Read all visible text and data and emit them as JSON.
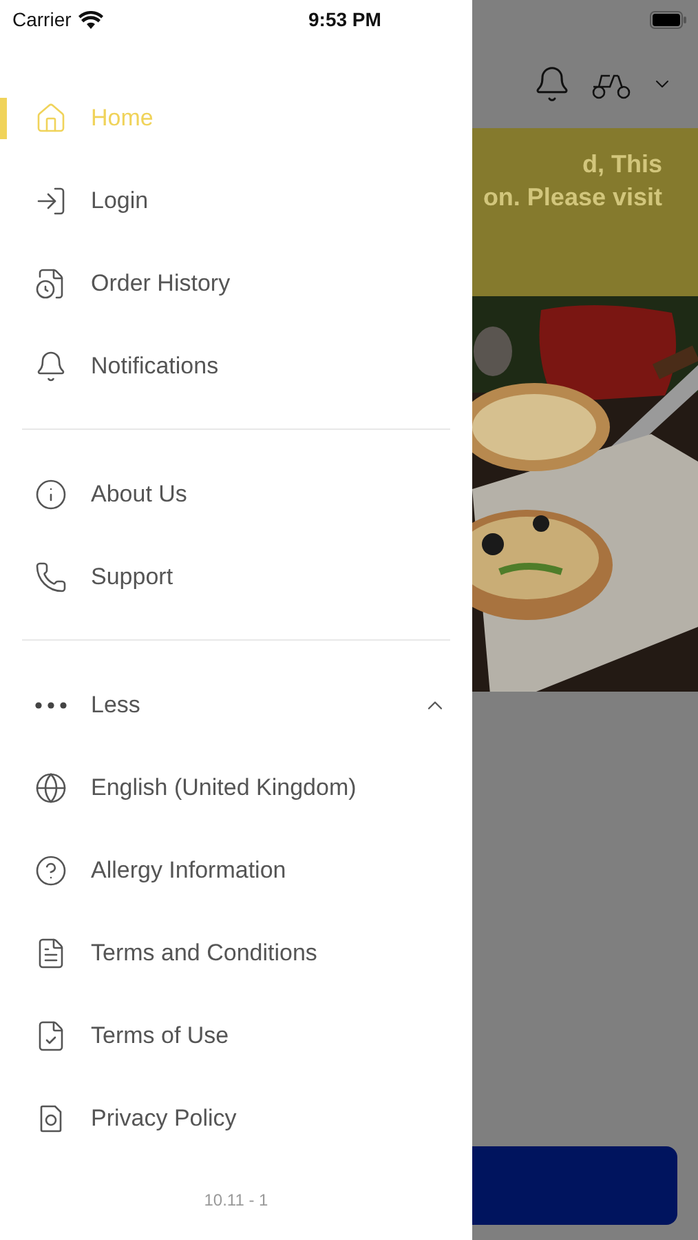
{
  "status_bar": {
    "carrier": "Carrier",
    "time": "9:53 PM"
  },
  "drawer": {
    "sections": [
      {
        "items": [
          {
            "label": "Home",
            "selected": true
          },
          {
            "label": "Login",
            "selected": false
          },
          {
            "label": "Order History",
            "selected": false
          },
          {
            "label": "Notifications",
            "selected": false
          }
        ]
      },
      {
        "items": [
          {
            "label": "About Us",
            "selected": false
          },
          {
            "label": "Support",
            "selected": false
          }
        ]
      }
    ],
    "more_toggle": {
      "label": "Less",
      "expanded": true
    },
    "more_items": [
      {
        "label": "English (United Kingdom)",
        "selected": false
      },
      {
        "label": "Allergy Information",
        "selected": false
      },
      {
        "label": "Terms and Conditions",
        "selected": false
      },
      {
        "label": "Terms of Use",
        "selected": false
      },
      {
        "label": "Privacy Policy",
        "selected": false
      }
    ],
    "version": "10.11 - 1"
  },
  "background": {
    "banner_lines": [
      "d, This",
      "on. Please visit"
    ]
  }
}
